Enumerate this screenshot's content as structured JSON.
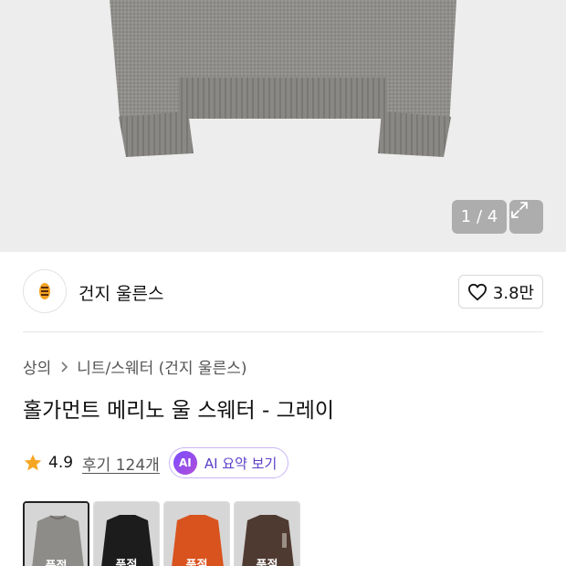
{
  "gallery": {
    "counter": "1 / 4",
    "icons": {
      "expand": "expand-icon"
    }
  },
  "brand": {
    "name": "건지 울른스",
    "logo_icon": "brand-logo-icon",
    "like_count": "3.8만",
    "like_icon": "heart-outline-icon"
  },
  "breadcrumb": {
    "items": [
      "상의",
      "니트/스웨터 (건지 울른스)"
    ],
    "separator_icon": "chevron-right-icon"
  },
  "product": {
    "title": "홀가먼트 메리노 울 스웨터 - 그레이"
  },
  "rating": {
    "score": "4.9",
    "reviews_label": "후기 124개",
    "star_icon": "star-icon",
    "star_color": "#f5a623",
    "ai_badge": "AI",
    "ai_label": "AI 요약 보기"
  },
  "swatches": {
    "items": [
      {
        "color": "#8e8c89",
        "label": "품절",
        "selected": true
      },
      {
        "color": "#1c1c1c",
        "label": "품절",
        "selected": false
      },
      {
        "color": "#d9531e",
        "label": "품절",
        "selected": false
      },
      {
        "color": "#4f3a32",
        "label": "품절",
        "selected": false
      }
    ]
  }
}
